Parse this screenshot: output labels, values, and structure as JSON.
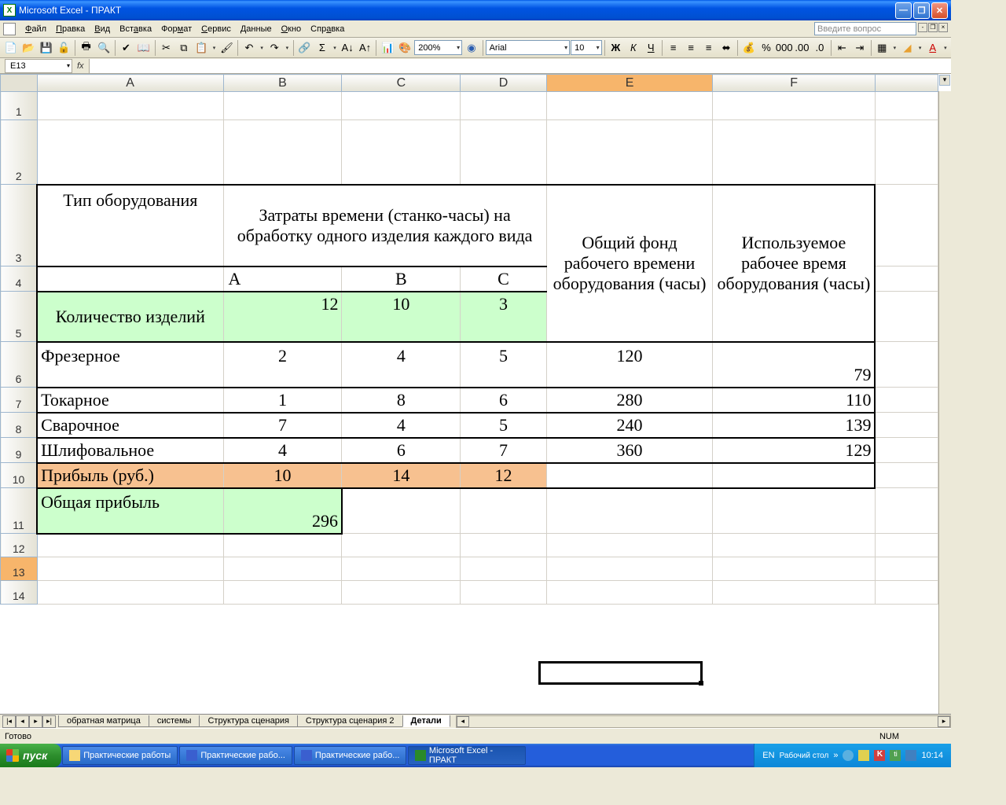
{
  "titlebar": {
    "text": "Microsoft Excel - ПРАКТ"
  },
  "menu": {
    "file": "Файл",
    "edit": "Правка",
    "view": "Вид",
    "insert": "Вставка",
    "format": "Формат",
    "service": "Сервис",
    "data": "Данные",
    "window": "Окно",
    "help": "Справка",
    "question_placeholder": "Введите вопрос"
  },
  "toolbar": {
    "zoom": "200%",
    "font": "Arial",
    "size": "10"
  },
  "namebox": "E13",
  "formula": "",
  "columns": [
    "A",
    "B",
    "C",
    "D",
    "E",
    "F"
  ],
  "rows": {
    "r1": "1",
    "r2": "2",
    "r3": "3",
    "r4": "4",
    "r5": "5",
    "r6": "6",
    "r7": "7",
    "r8": "8",
    "r9": "9",
    "r10": "10",
    "r11": "11",
    "r12": "12",
    "r13": "13",
    "r14": "14"
  },
  "cells": {
    "A3": "Тип оборудования",
    "B3": "Затраты времени (станко-часы) на обработку одного изделия каждого вида",
    "E3": "Общий фонд рабочего времени оборудования (часы)",
    "F3": "Используемое рабочее время оборудования (часы)",
    "B4": "А",
    "C4": "В",
    "D4": "С",
    "A5": "Количество изделий",
    "B5": "12",
    "C5": "10",
    "D5": "3",
    "A6": "Фрезерное",
    "B6": "2",
    "C6": "4",
    "D6": "5",
    "E6": "120",
    "F6": "79",
    "A7": "Токарное",
    "B7": "1",
    "C7": "8",
    "D7": "6",
    "E7": "280",
    "F7": "110",
    "A8": "Сварочное",
    "B8": "7",
    "C8": "4",
    "D8": "5",
    "E8": "240",
    "F8": "139",
    "A9": "Шлифовальное",
    "B9": "4",
    "C9": "6",
    "D9": "7",
    "E9": "360",
    "F9": "129",
    "A10": "Прибыль (руб.)",
    "B10": "10",
    "C10": "14",
    "D10": "12",
    "A11": "Общая  прибыль",
    "B11": "296"
  },
  "tabs": {
    "t1": "обратная матрица",
    "t2": "системы",
    "t3": "Структура сценария",
    "t4": "Структура сценария 2",
    "t5": "Детали"
  },
  "status": {
    "ready": "Готово",
    "num": "NUM"
  },
  "taskbar": {
    "start": "пуск",
    "i1": "Практические работы",
    "i2": "Практические рабо...",
    "i3": "Практические рабо...",
    "i4": "Microsoft Excel - ПРАКТ",
    "lang": "EN",
    "desk": "Рабочий стол",
    "time": "10:14"
  }
}
